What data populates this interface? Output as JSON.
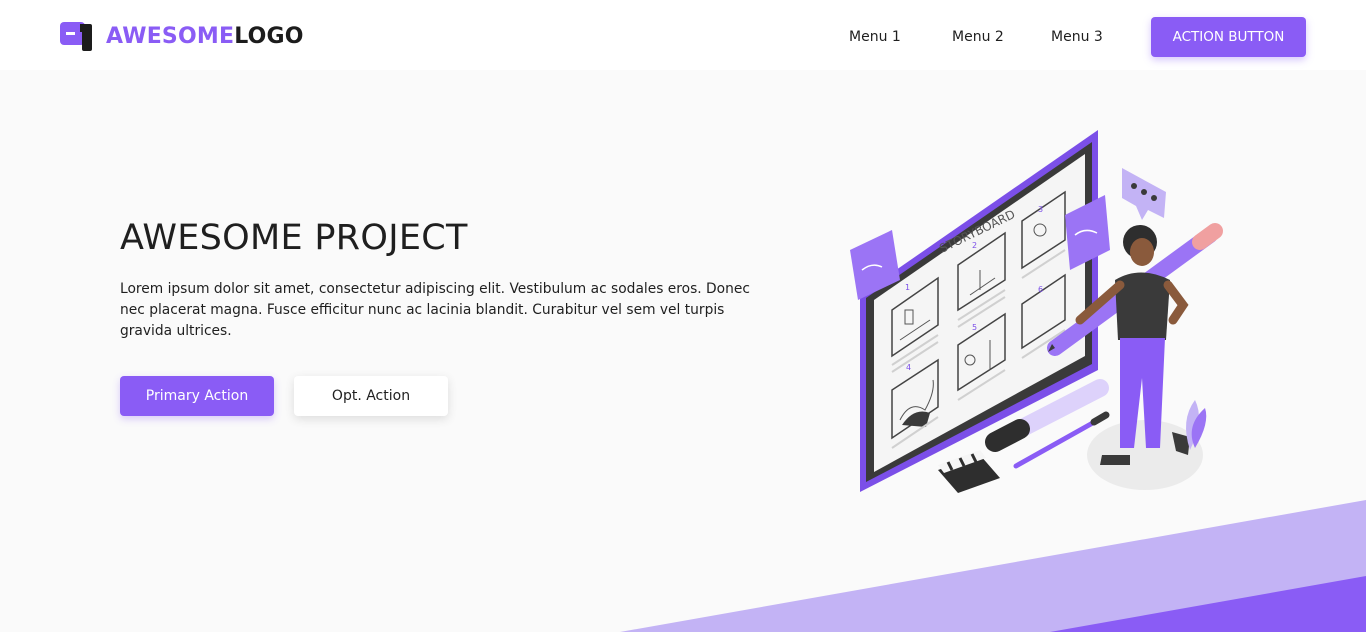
{
  "header": {
    "logo_part1": "AWESOME",
    "logo_part2": "LOGO",
    "nav": [
      "Menu 1",
      "Menu 2",
      "Menu 3"
    ],
    "action_label": "ACTION BUTTON"
  },
  "hero": {
    "title": "AWESOME PROJECT",
    "text": "Lorem ipsum dolor sit amet, consectetur adipiscing elit. Vestibulum ac sodales eros. Donec nec placerat magna. Fusce efficitur nunc ac lacinia blandit. Curabitur vel sem vel turpis gravida ultrices.",
    "primary_label": "Primary Action",
    "secondary_label": "Opt. Action"
  },
  "illustration": {
    "board_title": "STORYBOARD"
  },
  "colors": {
    "accent": "#8a5cf5",
    "accent_light": "#c3b3f5",
    "background": "#fafafa",
    "text": "#1f1f1f"
  }
}
